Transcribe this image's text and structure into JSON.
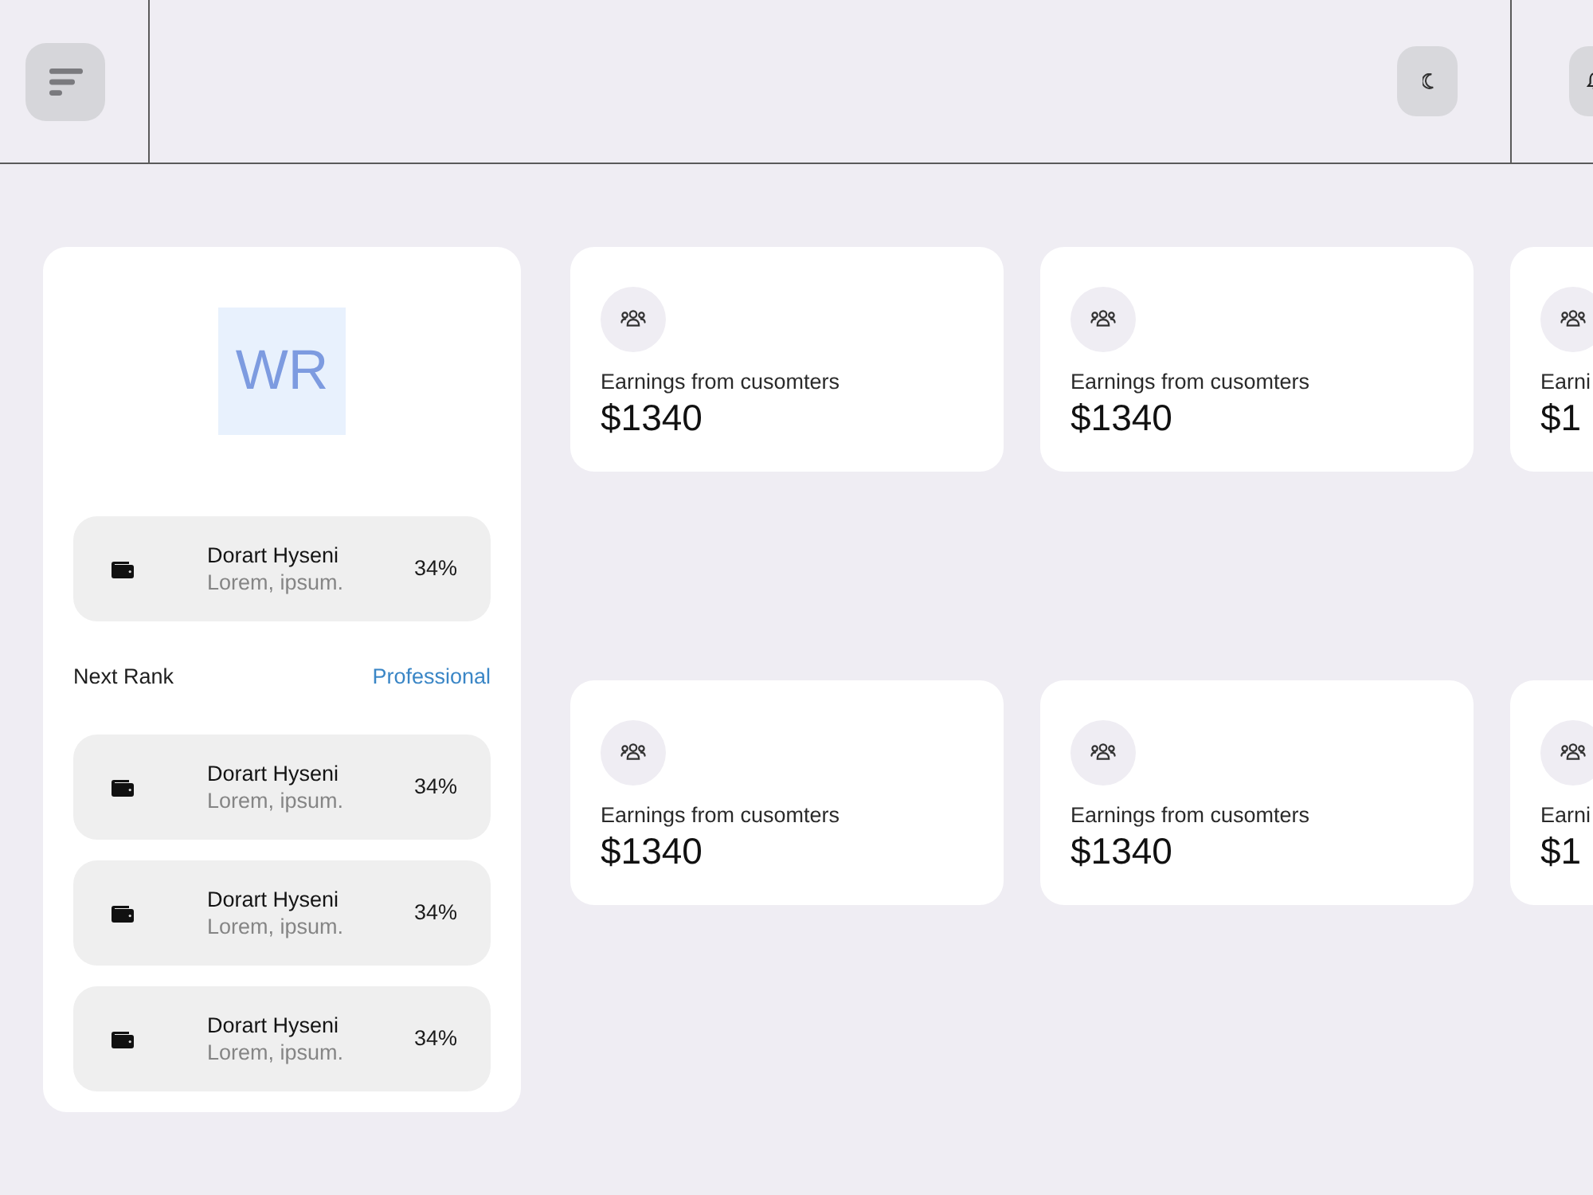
{
  "profile": {
    "initials": "WR",
    "featured": {
      "name": "Dorart Hyseni",
      "subtitle": "Lorem, ipsum.",
      "percent": "34%"
    },
    "next_rank": {
      "label": "Next Rank",
      "value": "Professional"
    },
    "items": [
      {
        "name": "Dorart Hyseni",
        "subtitle": "Lorem, ipsum.",
        "percent": "34%"
      },
      {
        "name": "Dorart Hyseni",
        "subtitle": "Lorem, ipsum.",
        "percent": "34%"
      },
      {
        "name": "Dorart Hyseni",
        "subtitle": "Lorem, ipsum.",
        "percent": "34%"
      }
    ]
  },
  "stat_rows": [
    {
      "cards": [
        {
          "label": "Earnings from cusomters",
          "value": "$1340"
        },
        {
          "label": "Earnings from cusomters",
          "value": "$1340"
        },
        {
          "label": "Earni",
          "value": "$1"
        }
      ]
    },
    {
      "cards": [
        {
          "label": "Earnings from cusomters",
          "value": "$1340"
        },
        {
          "label": "Earnings from cusomters",
          "value": "$1340"
        },
        {
          "label": "Earni",
          "value": "$1"
        }
      ]
    }
  ]
}
